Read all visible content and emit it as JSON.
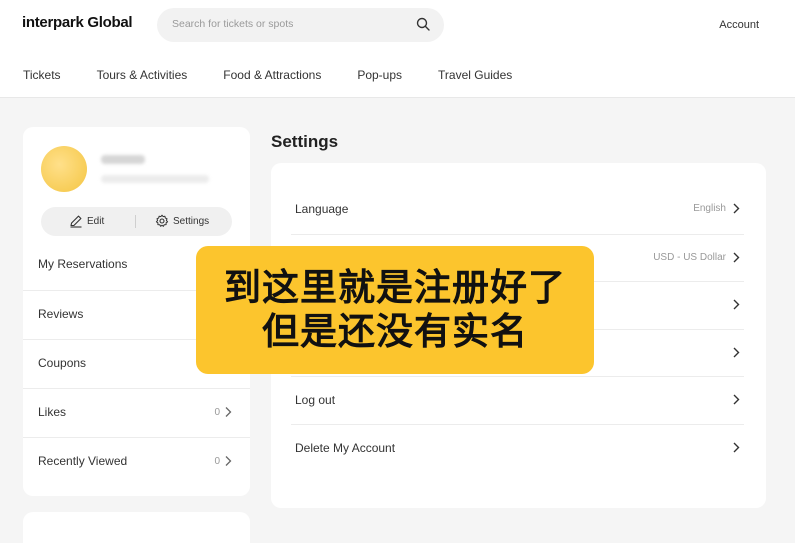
{
  "header": {
    "logo": "interpark Global",
    "search_placeholder": "Search for tickets or spots",
    "account": "Account"
  },
  "nav": [
    "Tickets",
    "Tours & Activities",
    "Food & Attractions",
    "Pop-ups",
    "Travel Guides"
  ],
  "profile": {
    "edit_label": "Edit",
    "settings_label": "Settings"
  },
  "sidebar": {
    "items": [
      {
        "label": "My Reservations",
        "count": ""
      },
      {
        "label": "Reviews",
        "count": ""
      },
      {
        "label": "Coupons",
        "count": ""
      },
      {
        "label": "Likes",
        "count": "0"
      },
      {
        "label": "Recently Viewed",
        "count": "0"
      }
    ]
  },
  "settings": {
    "title": "Settings",
    "rows": [
      {
        "label": "Language",
        "value": "English"
      },
      {
        "label": "",
        "value": "USD - US Dollar"
      },
      {
        "label": "",
        "value": ""
      },
      {
        "label": "",
        "value": ""
      },
      {
        "label": "Log out",
        "value": ""
      },
      {
        "label": "Delete My Account",
        "value": ""
      }
    ]
  },
  "overlay": {
    "line1": "到这里就是注册好了",
    "line2": "但是还没有实名"
  }
}
